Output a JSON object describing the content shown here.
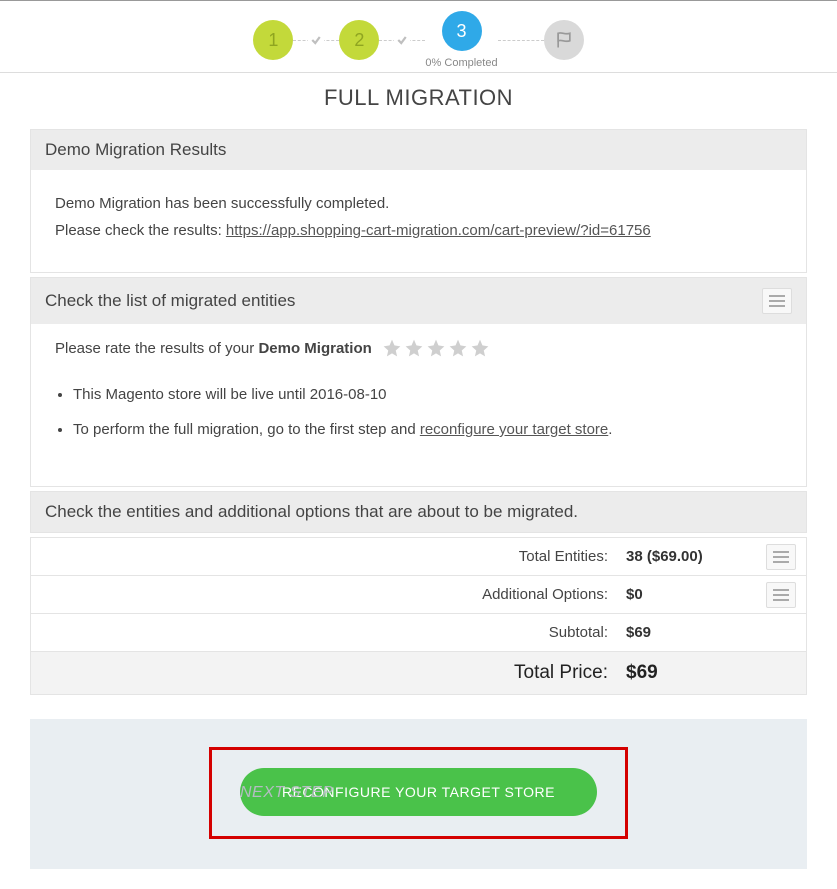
{
  "stepper": {
    "step1": "1",
    "step2": "2",
    "step3": "3",
    "step3_caption": "0% Completed"
  },
  "page_title": "FULL MIGRATION",
  "demo_results": {
    "heading": "Demo Migration Results",
    "line1": "Demo Migration has been successfully completed.",
    "line2_prefix": "Please check the results: ",
    "result_url": "https://app.shopping-cart-migration.com/cart-preview/?id=61756"
  },
  "entities_check": {
    "heading": "Check the list of migrated entities",
    "rate_prefix": "Please rate the results of your ",
    "rate_strong": "Demo Migration",
    "bullet1": "This Magento store will be live until 2016-08-10",
    "bullet2_prefix": "To perform the full migration, go to the first step and ",
    "bullet2_link": "reconfigure your target store",
    "bullet2_suffix": "."
  },
  "options_check": {
    "heading": "Check the entities and additional options that are about to be migrated."
  },
  "totals": {
    "entities_label": "Total Entities:",
    "entities_value": "38 ($69.00)",
    "additional_label": "Additional Options:",
    "additional_value": "$0",
    "subtotal_label": "Subtotal:",
    "subtotal_value": "$69",
    "total_label": "Total Price:",
    "total_value": "$69"
  },
  "footer": {
    "next_step": "NEXT STEP",
    "reconfigure_btn": "RECONFIGURE YOUR TARGET STORE"
  }
}
